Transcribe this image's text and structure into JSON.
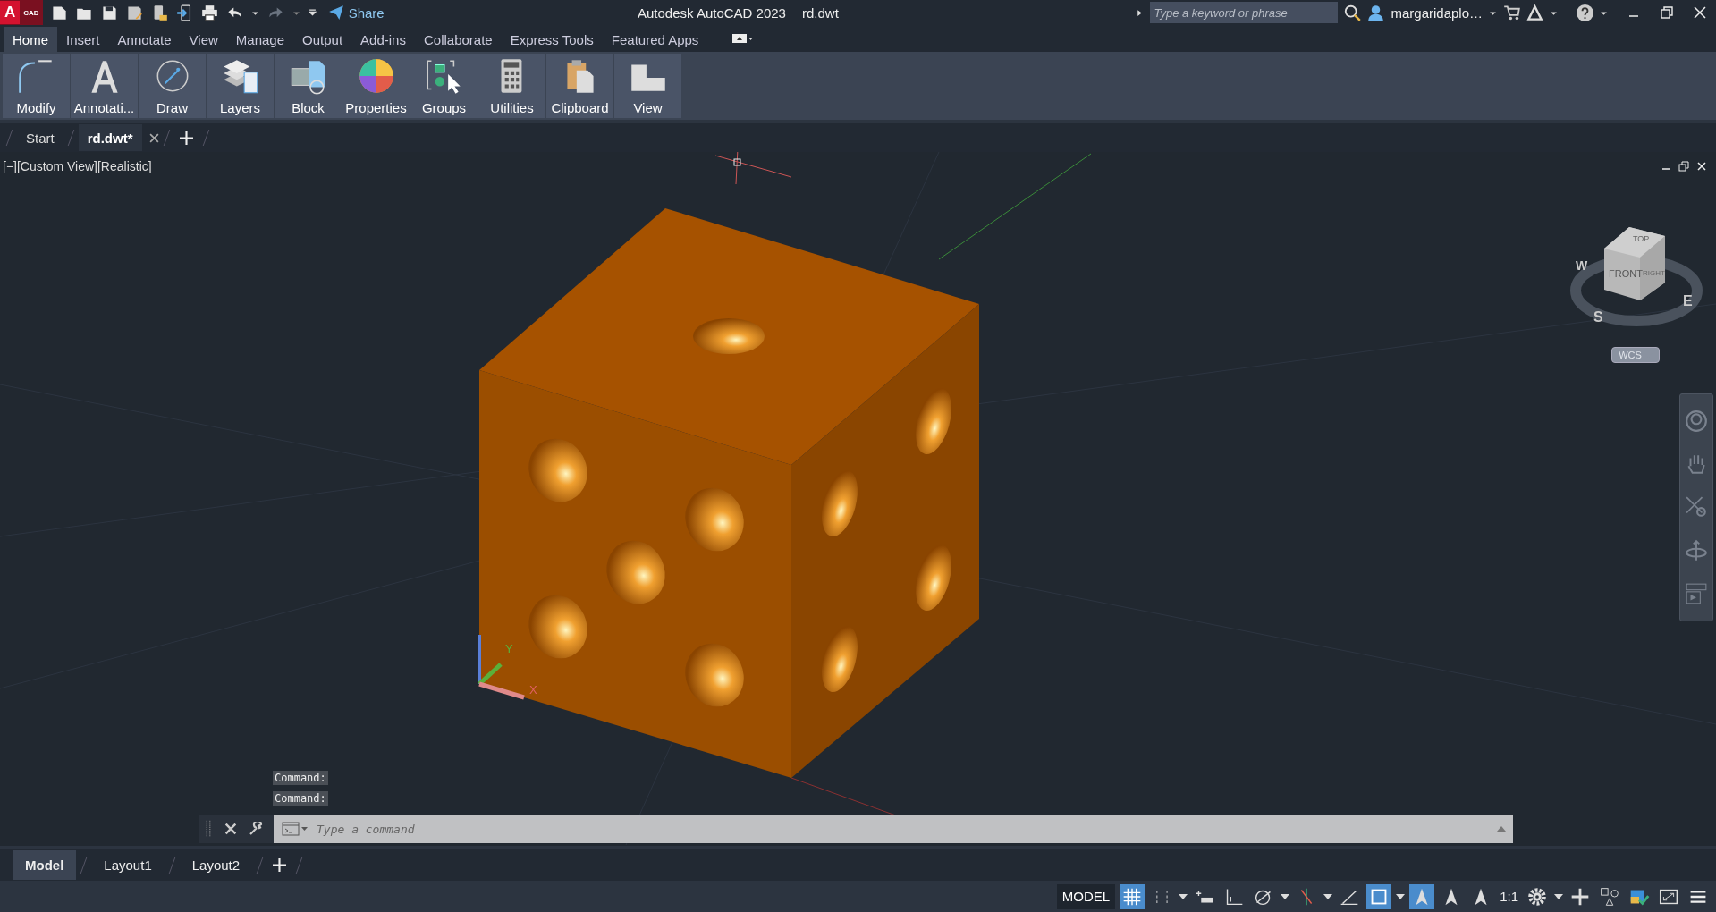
{
  "app": {
    "logo_letter": "A",
    "logo_badge": "CAD"
  },
  "quick_access": {
    "share_label": "Share"
  },
  "title": {
    "app_name": "Autodesk AutoCAD 2023",
    "file_name": "rd.dwt"
  },
  "search": {
    "placeholder": "Type a keyword or phrase"
  },
  "user": {
    "name": "margaridaplo…"
  },
  "ribbon_tabs": [
    {
      "label": "Home",
      "selected": true
    },
    {
      "label": "Insert",
      "selected": false
    },
    {
      "label": "Annotate",
      "selected": false
    },
    {
      "label": "View",
      "selected": false
    },
    {
      "label": "Manage",
      "selected": false
    },
    {
      "label": "Output",
      "selected": false
    },
    {
      "label": "Add-ins",
      "selected": false
    },
    {
      "label": "Collaborate",
      "selected": false
    },
    {
      "label": "Express Tools",
      "selected": false
    },
    {
      "label": "Featured Apps",
      "selected": false
    }
  ],
  "ribbon_panels": [
    {
      "label": "Modify",
      "kind": "modify"
    },
    {
      "label": "Annotati...",
      "kind": "annotation"
    },
    {
      "label": "Draw",
      "kind": "draw"
    },
    {
      "label": "Layers",
      "kind": "layers"
    },
    {
      "label": "Block",
      "kind": "block"
    },
    {
      "label": "Properties",
      "kind": "properties"
    },
    {
      "label": "Groups",
      "kind": "groups"
    },
    {
      "label": "Utilities",
      "kind": "utilities"
    },
    {
      "label": "Clipboard",
      "kind": "clipboard"
    },
    {
      "label": "View",
      "kind": "view"
    }
  ],
  "file_tabs": [
    {
      "label": "Start",
      "selected": false,
      "closable": false
    },
    {
      "label": "rd.dwt*",
      "selected": true,
      "closable": true
    }
  ],
  "viewport": {
    "label": "[−][Custom View][Realistic]",
    "axis_labels": [
      "X",
      "Y"
    ]
  },
  "viewcube": {
    "faces": [
      "TOP",
      "FRONT",
      "RIGHT"
    ],
    "compass": [
      "W",
      "S",
      "E"
    ],
    "ucs": "WCS"
  },
  "command_history": [
    "Command:",
    "Command:"
  ],
  "command_line": {
    "placeholder": "Type a command"
  },
  "layout_tabs": [
    {
      "label": "Model",
      "selected": true
    },
    {
      "label": "Layout1",
      "selected": false
    },
    {
      "label": "Layout2",
      "selected": false
    }
  ],
  "status_bar": {
    "model_label": "MODEL",
    "items": [
      {
        "kind": "grid",
        "on": true
      },
      {
        "kind": "snap",
        "on": false
      },
      {
        "kind": "caret"
      },
      {
        "kind": "dynamic",
        "on": false
      },
      {
        "kind": "ortho",
        "on": false
      },
      {
        "kind": "polar",
        "on": false
      },
      {
        "kind": "caret"
      },
      {
        "kind": "track",
        "on": false
      },
      {
        "kind": "caret"
      },
      {
        "kind": "angle",
        "on": false
      },
      {
        "kind": "select",
        "on": true
      },
      {
        "kind": "caret"
      },
      {
        "kind": "annovis",
        "on": true
      },
      {
        "kind": "autoscale",
        "on": false
      },
      {
        "kind": "annoscale",
        "on": false
      },
      {
        "kind": "scale",
        "label": "1:1"
      },
      {
        "kind": "gear",
        "on": false
      },
      {
        "kind": "caret"
      },
      {
        "kind": "plus",
        "on": false
      },
      {
        "kind": "isolate",
        "on": false
      },
      {
        "kind": "hardware",
        "on": false
      },
      {
        "kind": "fullscreen",
        "on": false
      },
      {
        "kind": "menu",
        "on": false
      }
    ]
  }
}
